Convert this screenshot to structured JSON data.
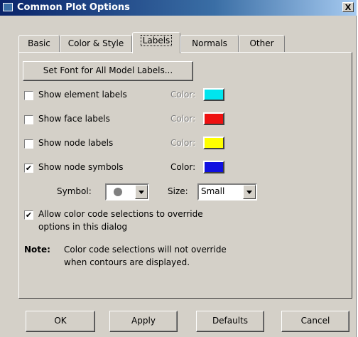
{
  "window": {
    "title": "Common Plot Options",
    "close_glyph": "X"
  },
  "tabs": [
    "Basic",
    "Color & Style",
    "Labels",
    "Normals",
    "Other"
  ],
  "active_tab": "Labels",
  "set_font_button": "Set Font for All Model Labels...",
  "label_options": [
    {
      "label": "Show element labels",
      "checked": false,
      "color_label": "Color:",
      "color": "#00e5ee",
      "enabled": false
    },
    {
      "label": "Show face labels",
      "checked": false,
      "color_label": "Color:",
      "color": "#ee1111",
      "enabled": false
    },
    {
      "label": "Show node labels",
      "checked": false,
      "color_label": "Color:",
      "color": "#ffff00",
      "enabled": false
    },
    {
      "label": "Show node symbols",
      "checked": true,
      "color_label": "Color:",
      "color": "#1010e0",
      "enabled": true
    }
  ],
  "symbol": {
    "label": "Symbol:",
    "value_icon": "filled-circle"
  },
  "size": {
    "label": "Size:",
    "value": "Small"
  },
  "allow_override": {
    "checked": true,
    "line1": "Allow color code selections to override",
    "line2": "options in this dialog"
  },
  "note": {
    "label": "Note:",
    "line1": "Color code selections will not override",
    "line2": "when contours are displayed."
  },
  "buttons": {
    "ok": "OK",
    "apply": "Apply",
    "defaults": "Defaults",
    "cancel": "Cancel"
  }
}
